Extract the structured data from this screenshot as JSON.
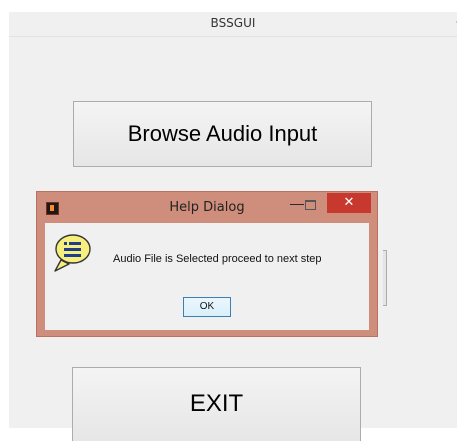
{
  "main_window": {
    "title": "BSSGUI",
    "edge_control": "-",
    "browse_label": "Browse Audio Input",
    "exit_label": "EXIT"
  },
  "dialog": {
    "title": "Help Dialog",
    "minimize_glyph": "—",
    "close_glyph": "✕",
    "message": "Audio File is Selected proceed to next step",
    "ok_label": "OK"
  },
  "colors": {
    "dialog_frame": "#cf8e7c",
    "close_button": "#c7392f",
    "help_icon": "#f6ef7e"
  },
  "icons": {
    "dialog_app": "matlab-icon",
    "dialog_message": "help-speech-bubble-icon"
  }
}
